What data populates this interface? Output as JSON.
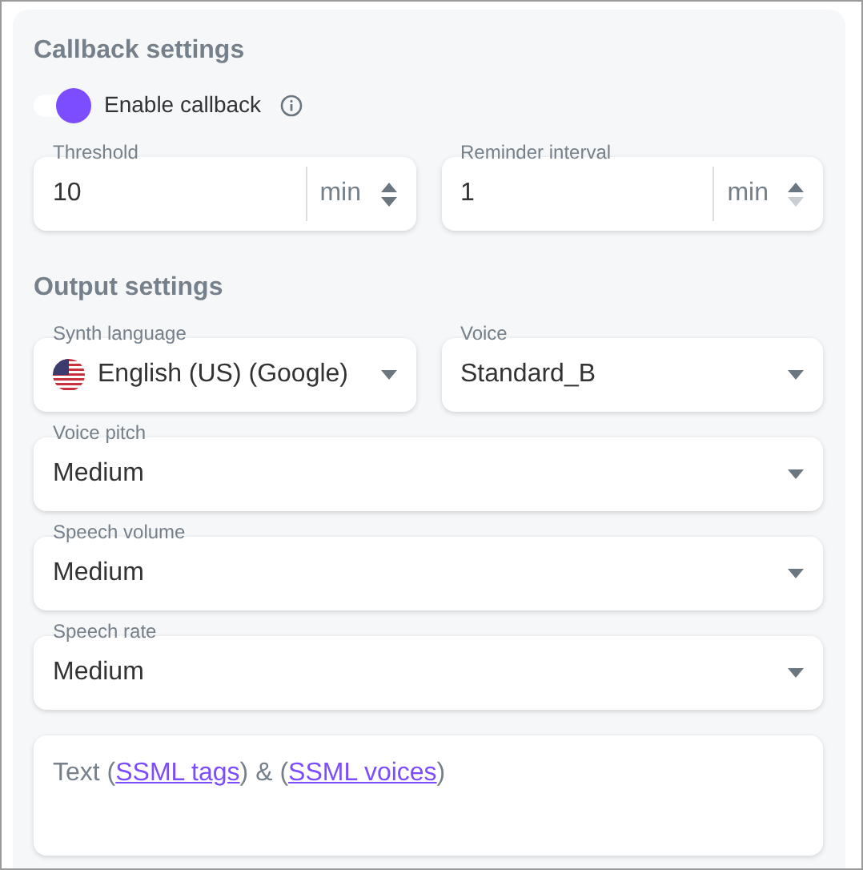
{
  "callback": {
    "title": "Callback settings",
    "toggle": {
      "label": "Enable callback",
      "on": true
    },
    "number_fields": [
      {
        "label": "Threshold",
        "value": "10",
        "unit": "min",
        "up_disabled": false,
        "down_disabled": false
      },
      {
        "label": "Reminder interval",
        "value": "1",
        "unit": "min",
        "up_disabled": false,
        "down_disabled": true
      }
    ]
  },
  "output": {
    "title": "Output settings",
    "rows": [
      [
        {
          "kind": "language-select",
          "label": "Synth language",
          "value": "English (US) (Google)"
        },
        {
          "kind": "select",
          "label": "Voice",
          "value": "Standard_B"
        }
      ],
      [
        {
          "kind": "select",
          "label": "Voice pitch",
          "value": "Medium"
        }
      ],
      [
        {
          "kind": "select",
          "label": "Speech volume",
          "value": "Medium"
        }
      ],
      [
        {
          "kind": "select",
          "label": "Speech rate",
          "value": "Medium"
        }
      ]
    ],
    "text_field": {
      "parts": [
        {
          "kind": "text",
          "text": "Text ("
        },
        {
          "kind": "link",
          "text": "SSML tags"
        },
        {
          "kind": "text",
          "text": ") & ("
        },
        {
          "kind": "link",
          "text": "SSML voices"
        },
        {
          "kind": "text",
          "text": ")"
        }
      ]
    }
  }
}
